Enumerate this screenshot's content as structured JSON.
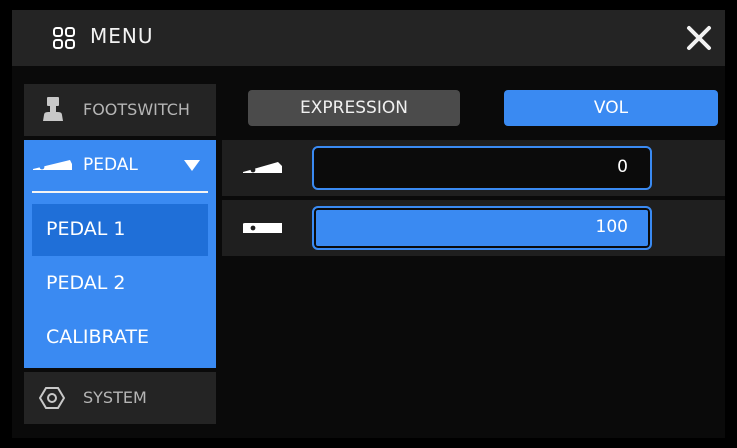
{
  "header": {
    "title": "MENU",
    "menu_icon": "grid-icon",
    "close_icon": "close-icon"
  },
  "sidebar": {
    "footswitch_label": "FOOTSWITCH",
    "pedal_label": "PEDAL",
    "pedal_items": [
      "PEDAL 1",
      "PEDAL 2",
      "CALIBRATE"
    ],
    "selected_item": "PEDAL 1",
    "system_label": "SYSTEM"
  },
  "tabs": {
    "expression_label": "EXPRESSION",
    "vol_label": "VOL",
    "active": "VOL"
  },
  "rows": [
    {
      "icon": "pedal-heel-icon",
      "value": "0"
    },
    {
      "icon": "pedal-toe-icon",
      "value": "100"
    }
  ],
  "colors": {
    "accent": "#3a8af2",
    "selected": "#1f6fd8",
    "panel": "#242424"
  }
}
